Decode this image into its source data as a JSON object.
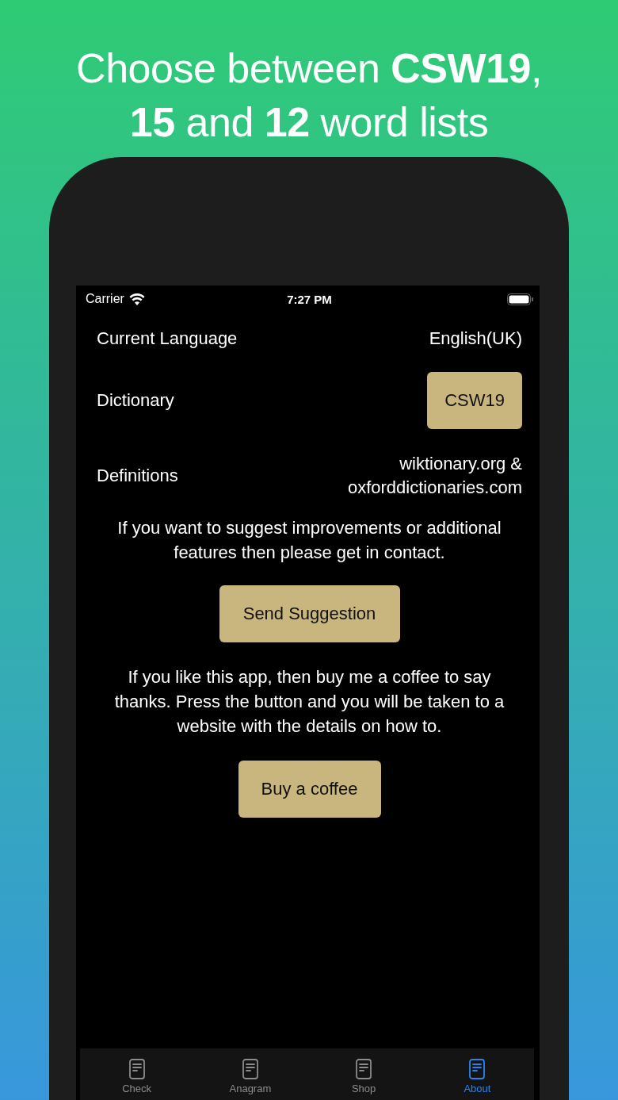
{
  "headline": "Choose between **CSW19**,\n**15** and **12** word lists",
  "status_bar": {
    "carrier": "Carrier",
    "time": "7:27 PM"
  },
  "settings": [
    {
      "label": "Current Language",
      "kind": "text",
      "value": "English(UK)"
    },
    {
      "label": "Dictionary",
      "kind": "button",
      "value": "CSW19"
    },
    {
      "label": "Definitions",
      "kind": "text",
      "value": "wiktionary.org &\noxforddictionaries.com"
    }
  ],
  "blocks": [
    {
      "kind": "paragraph",
      "text": "If you want to suggest improvements or additional features then please get in contact."
    },
    {
      "kind": "button",
      "text": "Send Suggestion"
    },
    {
      "kind": "paragraph",
      "text": "If you like this app, then buy me a coffee to say thanks. Press the button and you will be taken to a website with the details on how to."
    },
    {
      "kind": "button",
      "text": "Buy a coffee"
    }
  ],
  "tabs": [
    {
      "label": "Check",
      "selected": false
    },
    {
      "label": "Anagram",
      "selected": false
    },
    {
      "label": "Shop",
      "selected": false
    },
    {
      "label": "About",
      "selected": true
    }
  ]
}
